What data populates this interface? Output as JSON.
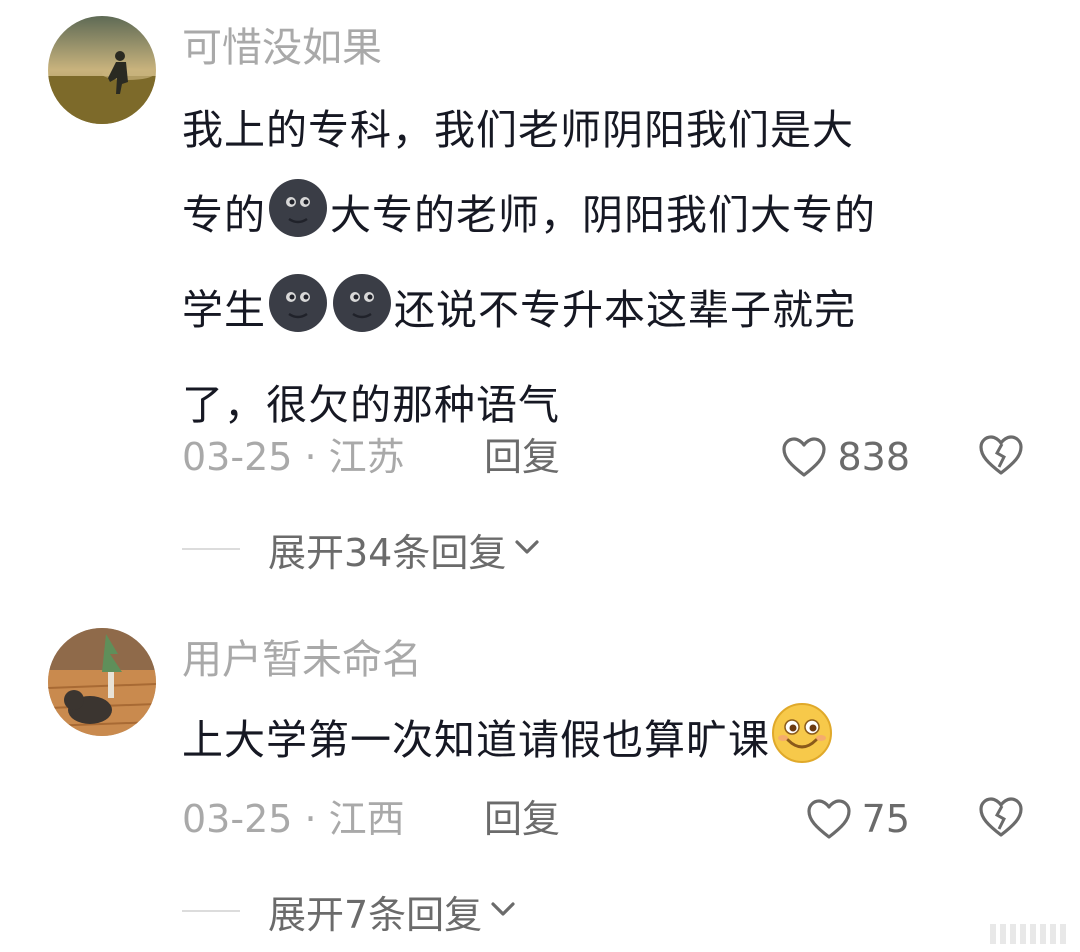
{
  "comments": [
    {
      "username": "可惜没如果",
      "text_lines": [
        [
          "我上的专科，我们老师阴阳我们是大"
        ],
        [
          "专的",
          "new-moon-face-emoji",
          "大专的老师，阴阳我们大专的"
        ],
        [
          "学生",
          "new-moon-face-emoji",
          "new-moon-face-emoji",
          "还说不专升本这辈子就完"
        ],
        [
          "了，很欠的那种语气"
        ]
      ],
      "date": "03-25 · 江苏",
      "reply_label": "回复",
      "likes": "838",
      "expand_label": "展开34条回复"
    },
    {
      "username": "用户暂未命名",
      "text_lines": [
        [
          "上大学第一次知道请假也算旷课",
          "smirk-face-emoji"
        ]
      ],
      "date": "03-25 · 江西",
      "reply_label": "回复",
      "likes": "75",
      "expand_label": "展开7条回复"
    }
  ],
  "colors": {
    "username": "#a9a9a9",
    "text": "#161823",
    "meta": "#a9a9a9",
    "action": "#6b6b6b"
  },
  "icons": [
    "heart-outline-icon",
    "broken-heart-icon",
    "chevron-down-icon"
  ]
}
